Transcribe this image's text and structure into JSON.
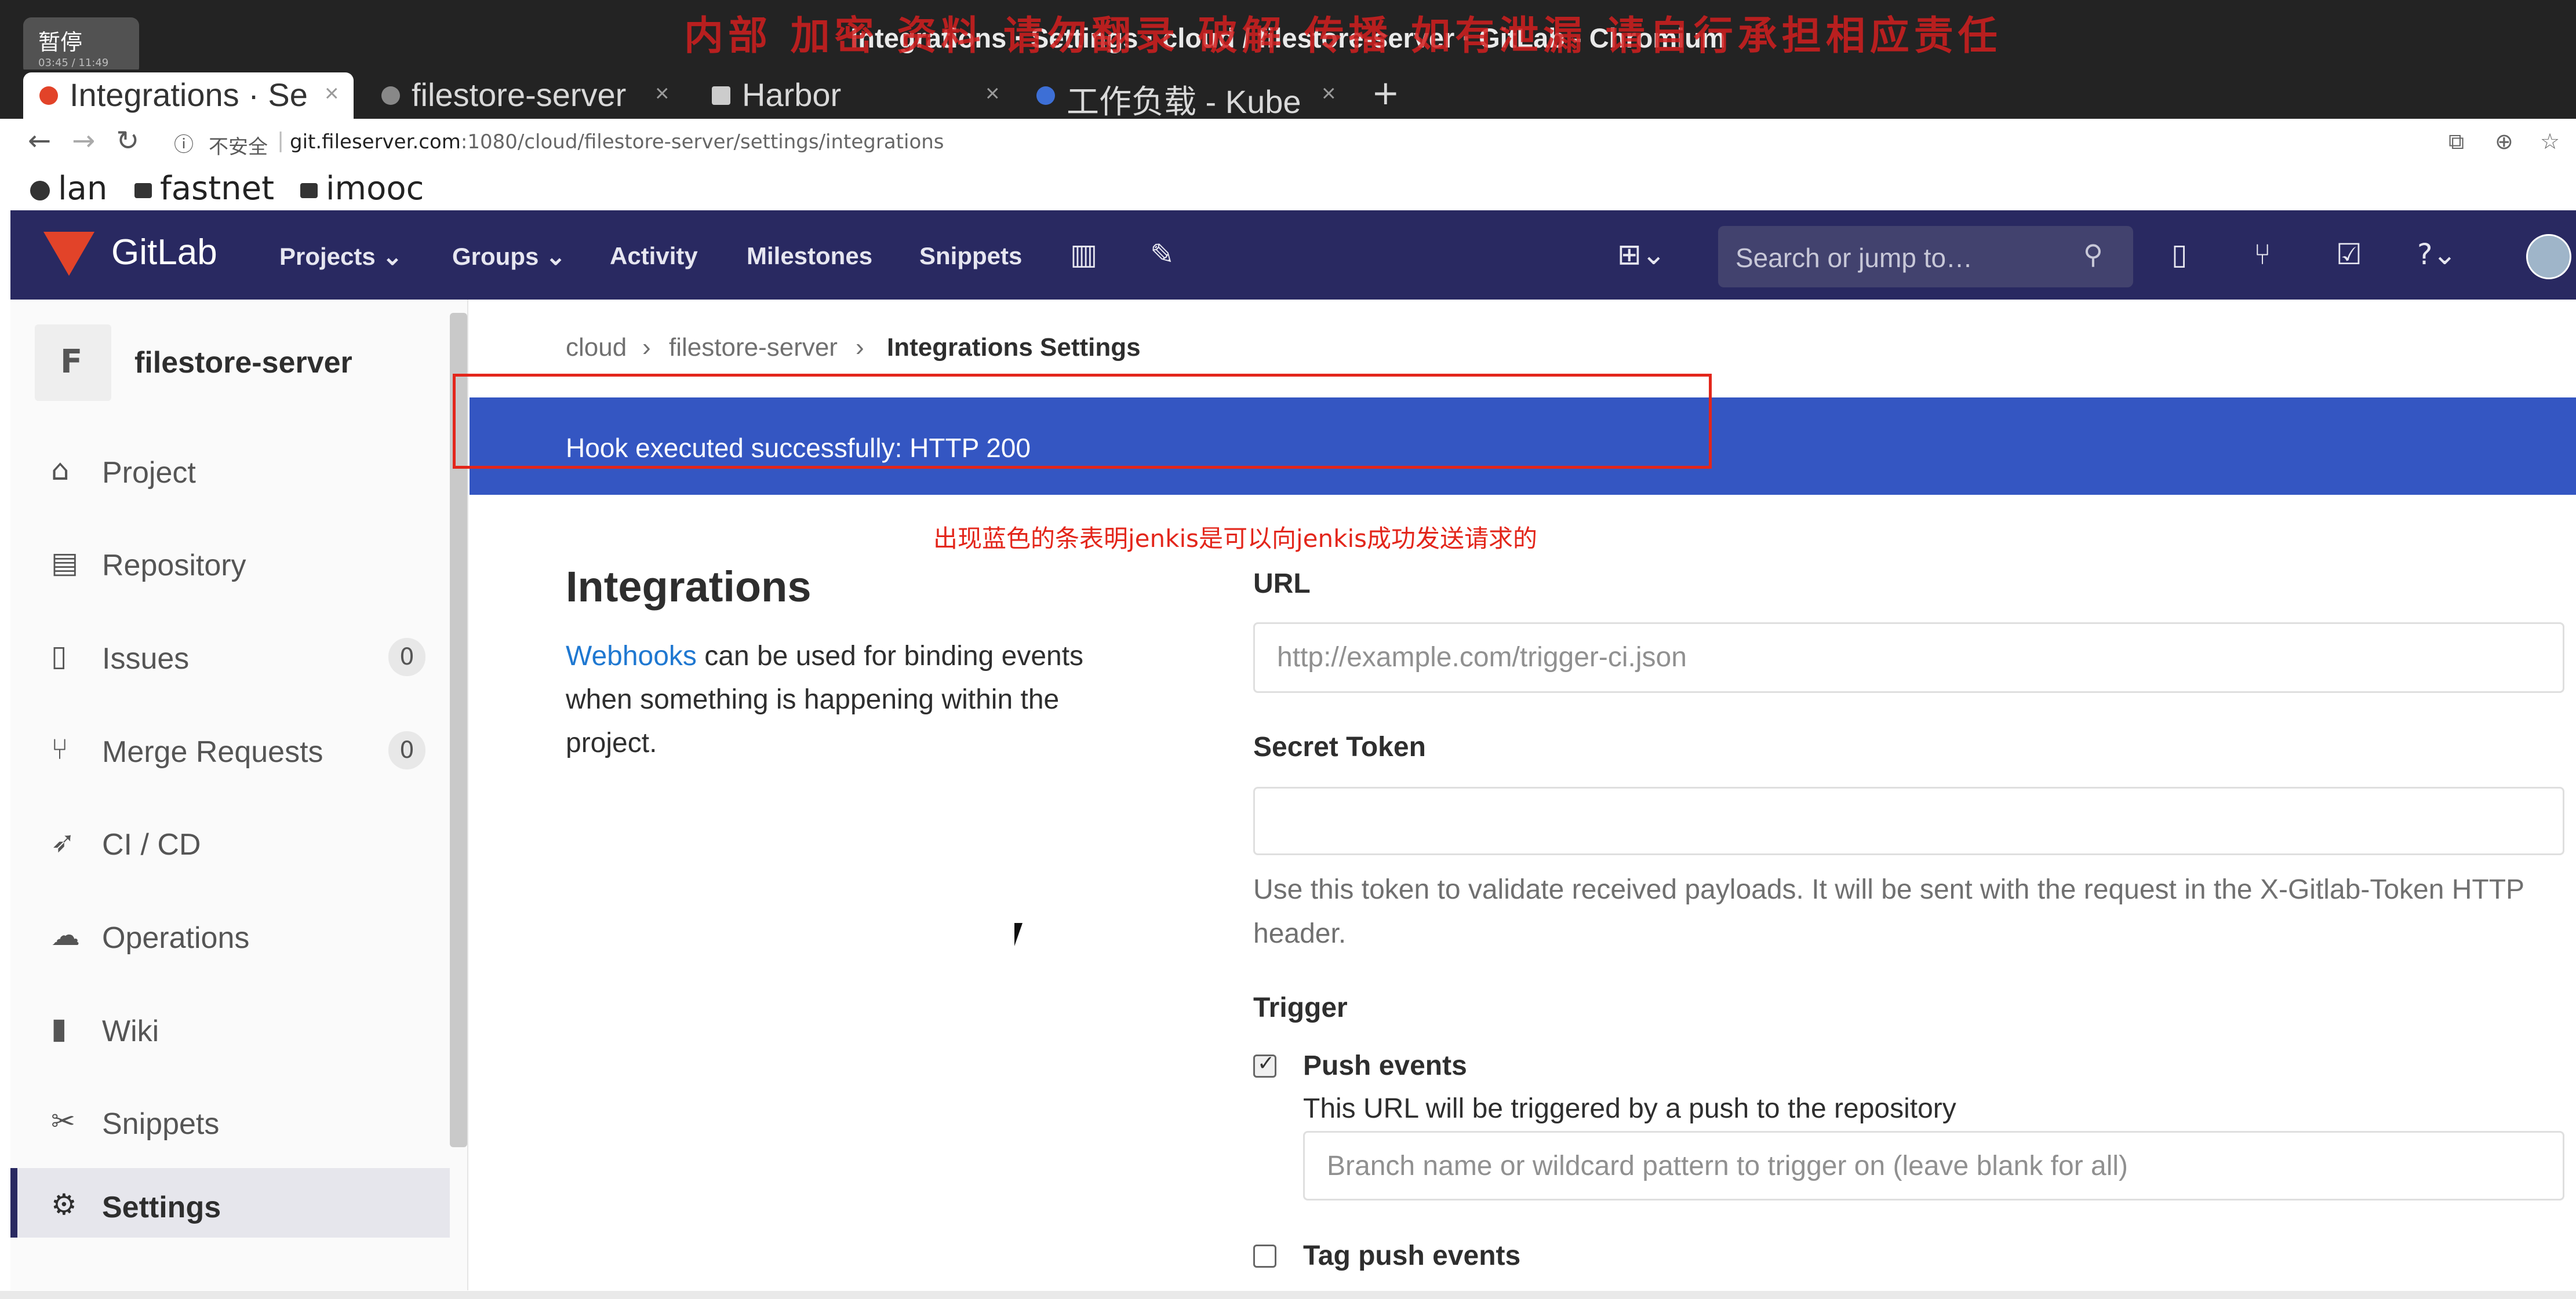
{
  "window": {
    "title": "Integrations · Settings · cloud / filestore-server · GitLab - Chromium",
    "watermark": "内部 加密 资料 请勿翻录 破解 传播 如有泄漏 请自行承担相应责任",
    "pause_label": "暂停",
    "pause_time": "03:45 / 11:49"
  },
  "tabs": [
    {
      "label": "Integrations · Se",
      "active": true
    },
    {
      "label": "filestore-server",
      "active": false
    },
    {
      "label": "Harbor",
      "active": false
    },
    {
      "label": "工作负载 - Kube",
      "active": false
    }
  ],
  "toolbar": {
    "insecure_label": "不安全",
    "url_host": "git.fileserver.com",
    "url_path": ":1080/cloud/filestore-server/settings/integrations"
  },
  "bookmarks": [
    "lan",
    "fastnet",
    "imooc"
  ],
  "gitlab": {
    "brand": "GitLab",
    "nav": [
      "Projects",
      "Groups",
      "Activity",
      "Milestones",
      "Snippets"
    ],
    "search_placeholder": "Search or jump to…"
  },
  "sidebar": {
    "project_letter": "F",
    "project_name": "filestore-server",
    "items": [
      {
        "label": "Project",
        "icon": "home-icon"
      },
      {
        "label": "Repository",
        "icon": "repo-icon"
      },
      {
        "label": "Issues",
        "icon": "issues-icon",
        "badge": "0"
      },
      {
        "label": "Merge Requests",
        "icon": "merge-request-icon",
        "badge": "0"
      },
      {
        "label": "CI / CD",
        "icon": "rocket-icon"
      },
      {
        "label": "Operations",
        "icon": "cloud-gear-icon"
      },
      {
        "label": "Wiki",
        "icon": "book-icon"
      },
      {
        "label": "Snippets",
        "icon": "scissors-icon"
      },
      {
        "label": "Settings",
        "icon": "gear-icon",
        "active": true
      }
    ]
  },
  "breadcrumb": [
    "cloud",
    "filestore-server",
    "Integrations Settings"
  ],
  "flash": "Hook executed successfully: HTTP 200",
  "annotation": "出现蓝色的条表明jenkis是可以向jenkis成功发送请求的",
  "integrations": {
    "title": "Integrations",
    "desc_link": "Webhooks",
    "desc_text": " can be used for binding events when something is happening within the project."
  },
  "form": {
    "url_label": "URL",
    "url_placeholder": "http://example.com/trigger-ci.json",
    "token_label": "Secret Token",
    "token_help": "Use this token to validate received payloads. It will be sent with the request in the X-Gitlab-Token HTTP header.",
    "trigger_label": "Trigger",
    "push_label": "Push events",
    "push_desc": "This URL will be triggered by a push to the repository",
    "branch_placeholder": "Branch name or wildcard pattern to trigger on (leave blank for all)",
    "tag_push_label": "Tag push events",
    "push_checked": true,
    "tag_push_checked": false
  },
  "colors": {
    "header": "#292961",
    "flash": "#3456c2",
    "annotation": "#e3261b",
    "logo": "#e24329"
  }
}
